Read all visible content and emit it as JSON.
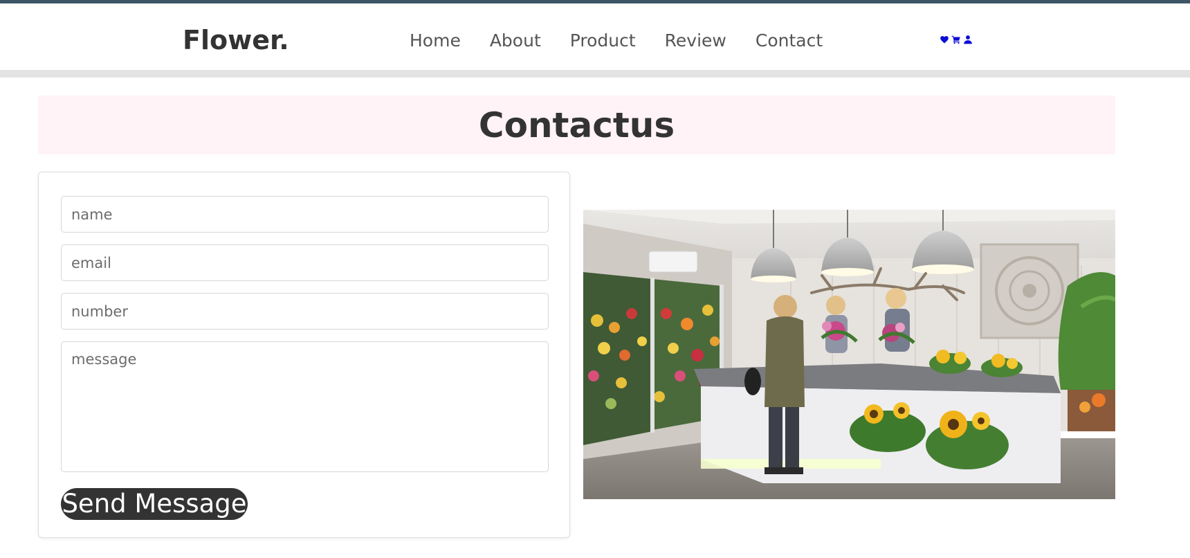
{
  "header": {
    "logo": "Flower.",
    "nav": [
      {
        "label": "Home"
      },
      {
        "label": "About"
      },
      {
        "label": "Product"
      },
      {
        "label": "Review"
      },
      {
        "label": "Contact"
      }
    ],
    "icons": [
      "heart-icon",
      "cart-icon",
      "user-icon"
    ],
    "icon_color": "#0b0bd6"
  },
  "banner": {
    "title": "Contactus",
    "background": "#fff3f8"
  },
  "form": {
    "name_placeholder": "name",
    "email_placeholder": "email",
    "number_placeholder": "number",
    "message_placeholder": "message",
    "send_label": "Send Message"
  },
  "image": {
    "subject": "flower-shop-interior-photo"
  },
  "colors": {
    "topline": "#3d5566",
    "text": "#333333",
    "button": "#333333"
  }
}
